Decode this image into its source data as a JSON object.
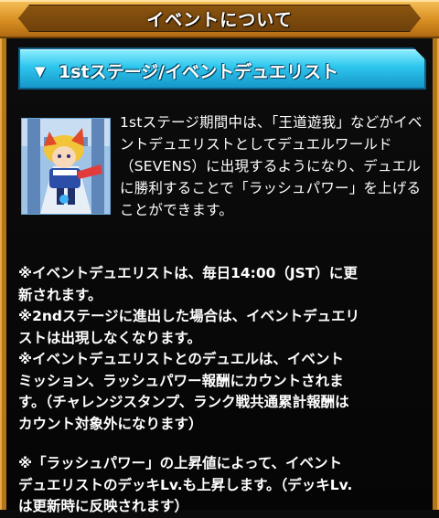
{
  "header": {
    "title": "イベントについて"
  },
  "section": {
    "toggle_icon": "triangle-down",
    "label": "1stステージ/イベントデュエリスト"
  },
  "thumbnail": {
    "icon": "duelist-character-portrait"
  },
  "lead_text": "1stステージ期間中は、「王道遊我」などがイベントデュエリストとしてデュエルワールド（SEVENS）に出現するようになり、デュエルに勝利することで「ラッシュパワー」を上げることができます。",
  "notes": [
    "※イベントデュエリストは、毎日14:00（JST）に更\n新されます。",
    "※2ndステージに進出した場合は、イベントデュエリ\nストは出現しなくなります。",
    "※イベントデュエリストとのデュエルは、イベント\nミッション、ラッシュパワー報酬にカウントされま\nす。（チャレンジスタンプ、ランク戦共通累計報酬は\nカウント対象外になります）",
    "※「ラッシュパワー」の上昇値によって、イベント\nデュエリストのデッキLv.も上昇します。（デッキLv.\nは更新時に反映されます）"
  ],
  "colors": {
    "title_bar": "#d88f22",
    "section_header": "#2ec6ee",
    "frame": "#b5761a",
    "background": "#0b0b0b"
  }
}
